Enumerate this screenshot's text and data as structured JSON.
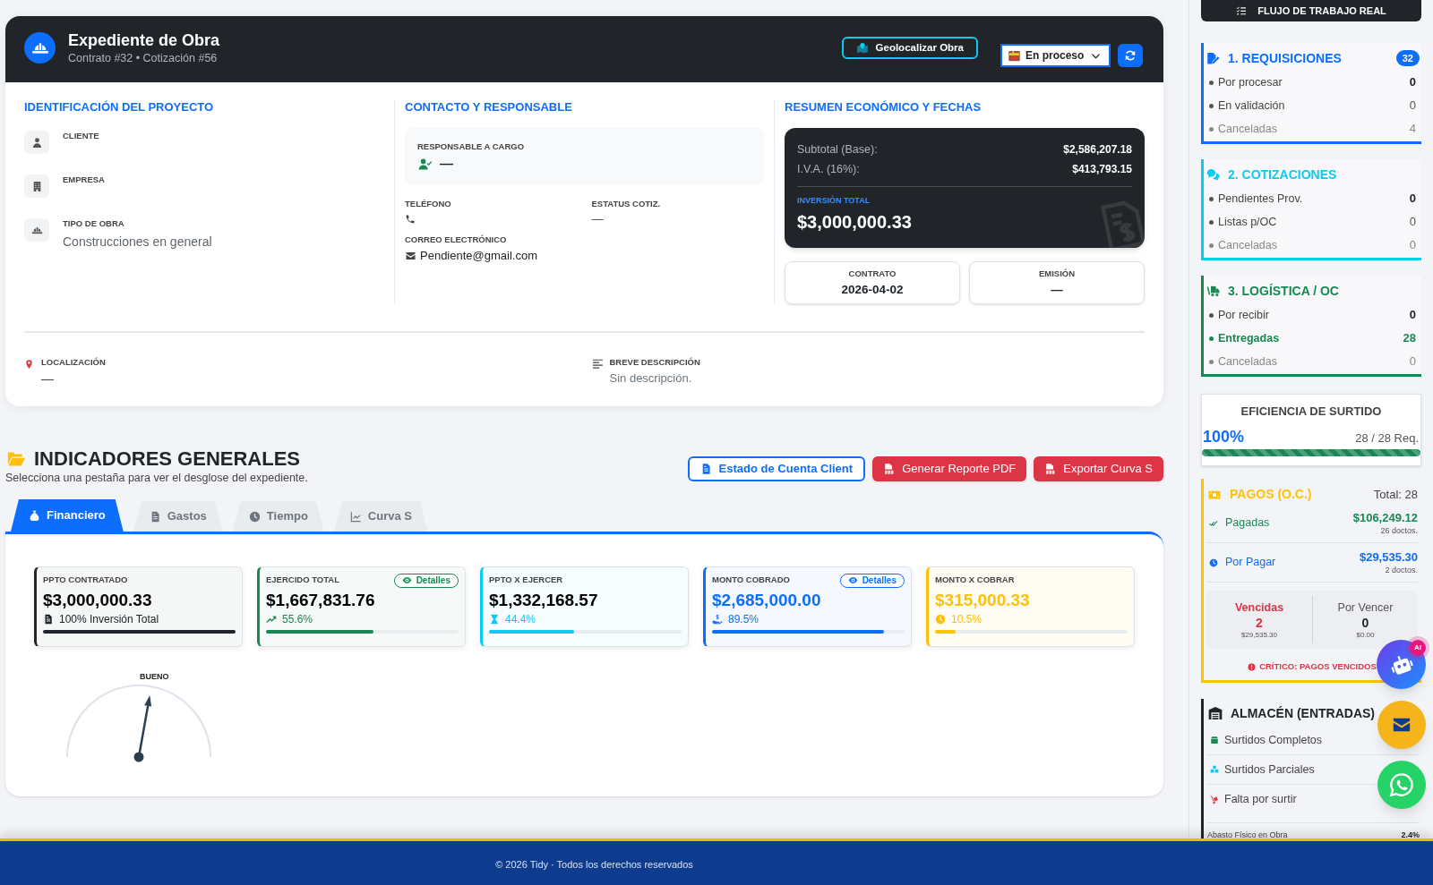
{
  "header": {
    "title": "Expediente de Obra",
    "subtitle": "Contrato #32 • Cotización #56",
    "geolocate_button": "Geolocalizar Obra",
    "status_select": {
      "value": "En proceso"
    }
  },
  "project": {
    "title": "IDENTIFICACIÓN DEL PROYECTO",
    "fields": [
      {
        "label": "CLIENTE"
      },
      {
        "label": "EMPRESA"
      },
      {
        "label": "TIPO DE OBRA",
        "value": "Construcciones en general"
      }
    ]
  },
  "contact": {
    "title": "CONTACTO Y RESPONSABLE",
    "responsible": {
      "label": "RESPONSABLE A CARGO",
      "value": "—"
    },
    "phone": {
      "label": "TELÉFONO"
    },
    "quote_status": {
      "label": "ESTATUS COTIZ.",
      "value": "—"
    },
    "email": {
      "label": "CORREO ELECTRÓNICO",
      "value": "Pendiente@gmail.com"
    }
  },
  "summary": {
    "title": "RESUMEN ECONÓMICO Y FECHAS",
    "lines": [
      {
        "label": "Subtotal (Base):",
        "value": "$2,586,207.18"
      },
      {
        "label": "I.V.A. (16%):",
        "value": "$413,793.15"
      }
    ],
    "total_label": "INVERSIÓN TOTAL",
    "total": "$3,000,000.33",
    "dates": [
      {
        "label": "CONTRATO",
        "value": "2026-04-02"
      },
      {
        "label": "EMISIÓN",
        "value": "—"
      }
    ]
  },
  "location": {
    "label": "LOCALIZACIÓN",
    "value": "—"
  },
  "description": {
    "label": "BREVE DESCRIPCIÓN",
    "value": "Sin descripción."
  },
  "indicators": {
    "title": "INDICADORES GENERALES",
    "subtitle": "Selecciona una pestaña para ver el desglose del expediente.",
    "buttons": [
      {
        "label": "Estado de Cuenta Client",
        "kind": "outline"
      },
      {
        "label": "Generar Reporte PDF",
        "kind": "danger"
      },
      {
        "label": "Exportar Curva S",
        "kind": "danger"
      }
    ],
    "tabs": [
      {
        "label": "Financiero",
        "selected": true
      },
      {
        "label": "Gastos",
        "selected": false
      },
      {
        "label": "Tiempo",
        "selected": false
      },
      {
        "label": "Curva S",
        "selected": false
      }
    ],
    "cards": [
      {
        "label": "PPTO CONTRATADO",
        "value": "$3,000,000.33",
        "note": "100% Inversión Total",
        "level": 1,
        "color": "#212529",
        "accent_value": false
      },
      {
        "label": "EJERCIDO TOTAL",
        "action": "Detalles",
        "value": "$1,667,831.76",
        "note": "55.6%",
        "level": 0.556,
        "color": "#198754",
        "accent_value": false
      },
      {
        "label": "PPTO X EJERCER",
        "value": "$1,332,168.57",
        "note": "44.4%",
        "level": 0.444,
        "color": "#0dcaf0",
        "accent_value": false
      },
      {
        "label": "MONTO COBRADO",
        "action": "Detalles",
        "value": "$2,685,000.00",
        "note": "89.5%",
        "level": 0.895,
        "color": "#0d6efd",
        "accent_value": true
      },
      {
        "label": "MONTO X COBRAR",
        "value": "$315,000.33",
        "note": "10.5%",
        "level": 0.105,
        "color": "#ffc107",
        "accent_value": true
      }
    ],
    "gauge": {
      "label": "BUENO",
      "level": 0.556
    }
  },
  "sidebar": {
    "header": "FLUJO DE TRABAJO REAL",
    "stages": [
      {
        "title": "1. REQUISICIONES",
        "color": "#0d6efd",
        "badge": "32",
        "rows": [
          {
            "label": "Por procesar",
            "value": "0",
            "kind": "pending"
          },
          {
            "label": "En validación",
            "value": "0",
            "kind": "normal"
          },
          {
            "label": "Canceladas",
            "value": "4",
            "kind": "cancelled"
          }
        ]
      },
      {
        "title": "2. COTIZACIONES",
        "color": "#0dcaf0",
        "rows": [
          {
            "label": "Pendientes Prov.",
            "value": "0",
            "kind": "pending"
          },
          {
            "label": "Listas p/OC",
            "value": "0",
            "kind": "normal"
          },
          {
            "label": "Canceladas",
            "value": "0",
            "kind": "cancelled"
          }
        ]
      },
      {
        "title": "3. LOGÍSTICA / OC",
        "color": "#198754",
        "rows": [
          {
            "label": "Por recibir",
            "value": "0",
            "kind": "pending"
          },
          {
            "label": "Entregadas",
            "value": "28",
            "kind": "success"
          },
          {
            "label": "Canceladas",
            "value": "0",
            "kind": "cancelled"
          }
        ]
      }
    ],
    "efficiency": {
      "title": "EFICIENCIA DE SURTIDO",
      "percent": "100%",
      "count": "28 / 28 Req.",
      "level": 1
    },
    "payments": {
      "title": "PAGOS (O.C.)",
      "total": "Total: 28",
      "rows": [
        {
          "label": "Pagadas",
          "amount": "$106,249.12",
          "docs": "26 doctos.",
          "color": "#198754"
        },
        {
          "label": "Por Pagar",
          "amount": "$29,535.30",
          "docs": "2 doctos.",
          "color": "#0d6efd"
        }
      ],
      "due": [
        {
          "label": "Vencidas",
          "count": "2",
          "amount": "$29,535.30",
          "kind": "overdue"
        },
        {
          "label": "Por Vencer",
          "count": "0",
          "amount": "$0.00",
          "kind": "upcoming"
        }
      ],
      "alert": "CRÍTICO: PAGOS VENCIDOS"
    },
    "warehouse": {
      "title": "ALMACÉN (ENTRADAS)",
      "rows": [
        {
          "label": "Surtidos Completos",
          "color": "#198754"
        },
        {
          "label": "Surtidos Parciales",
          "color": "#0dcaf0"
        },
        {
          "label": "Falta por surtir",
          "color": "#dc3545"
        }
      ],
      "supply": {
        "label": "Abasto Físico en Obra",
        "value": "2.4%"
      }
    }
  },
  "floating": {
    "ai_badge": "AI"
  },
  "footer": {
    "text": "© 2026 Tidy · Todos los derechos reservados"
  }
}
